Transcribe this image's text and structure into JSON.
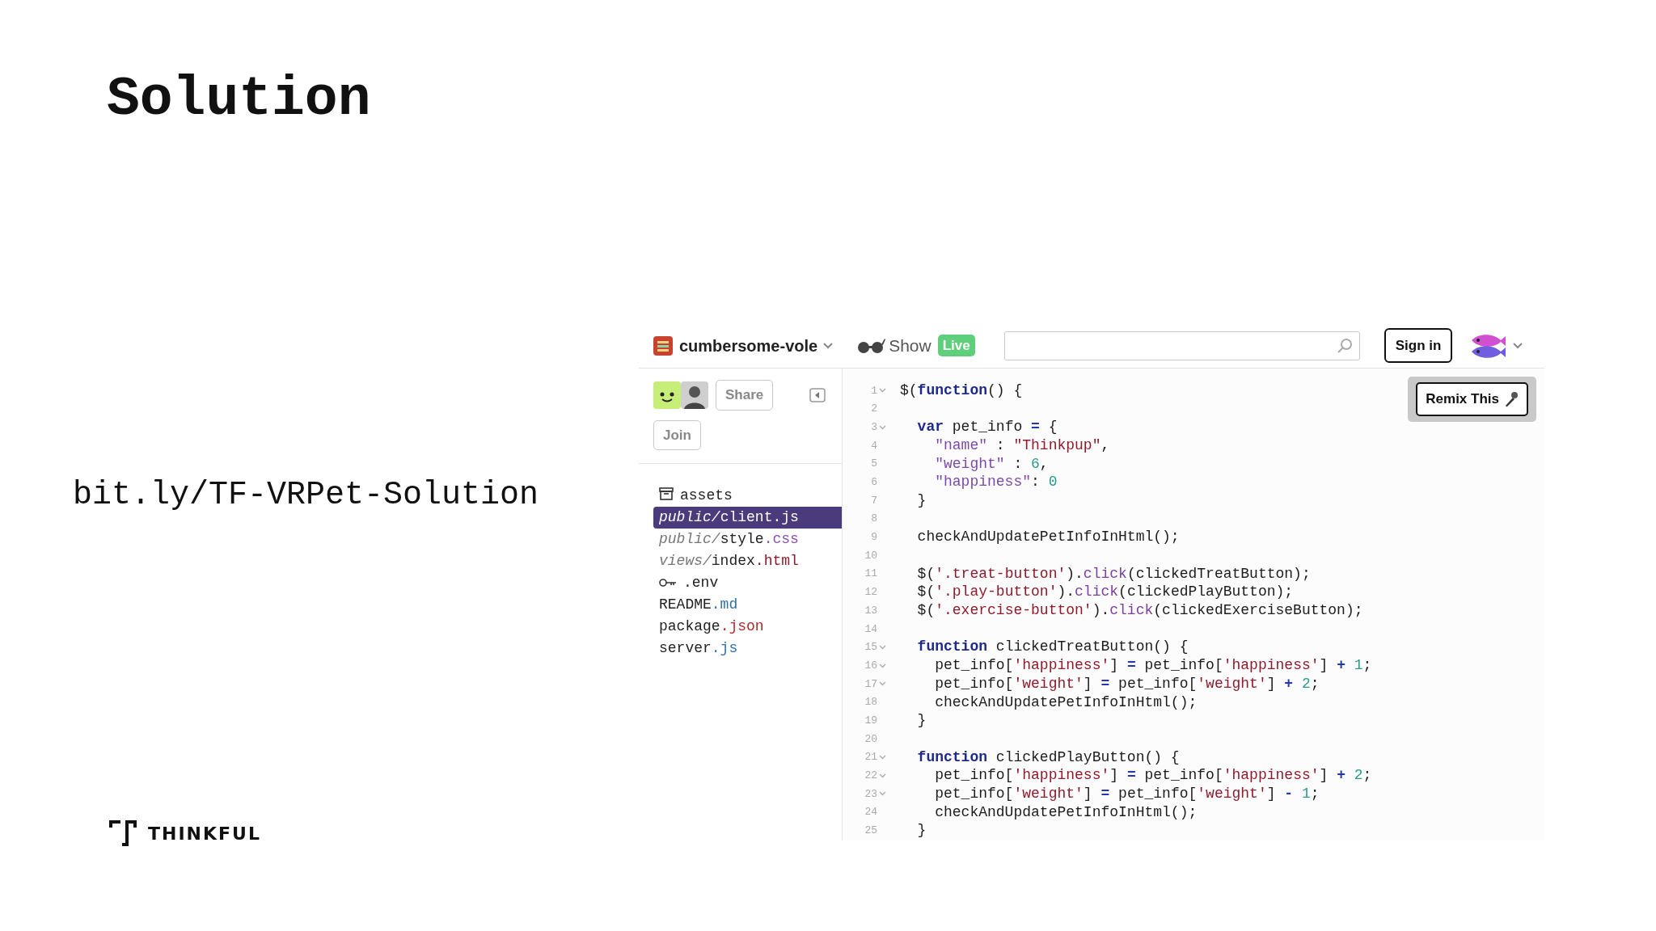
{
  "slide": {
    "title": "Solution",
    "link": "bit.ly/TF-VRPet-Solution",
    "brand": "THINKFUL"
  },
  "editor": {
    "project_name": "cumbersome-vole",
    "show_label": "Show",
    "live_badge": "Live",
    "sign_in": "Sign in",
    "share": "Share",
    "join": "Join",
    "remix": "Remix This",
    "files": [
      {
        "kind": "assets",
        "name": "assets",
        "selected": false
      },
      {
        "kind": "file",
        "dir": "public/",
        "name": "client",
        "ext": ".js",
        "selected": true
      },
      {
        "kind": "file",
        "dir": "public/",
        "name": "style",
        "ext": ".css",
        "color": "#8a4fb0",
        "selected": false
      },
      {
        "kind": "file",
        "dir": "views/",
        "name": "index",
        "ext": ".html",
        "color": "#8b1a2b",
        "selected": false
      },
      {
        "kind": "key",
        "name": ".env",
        "selected": false
      },
      {
        "kind": "file",
        "name": "README",
        "ext": ".md",
        "color": "#2f6fb0",
        "selected": false
      },
      {
        "kind": "file",
        "name": "package",
        "ext": ".json",
        "color": "#b02a2a",
        "selected": false
      },
      {
        "kind": "file",
        "name": "server",
        "ext": ".js",
        "color": "#2f6fb0",
        "selected": false
      }
    ],
    "code": [
      {
        "number": "1",
        "foldable": true,
        "tokens": [
          {
            "kind": "plain",
            "text": "$("
          },
          {
            "kind": "keyword",
            "text": "function"
          },
          {
            "kind": "plain",
            "text": "() {"
          }
        ]
      },
      {
        "number": "2",
        "foldable": false
      },
      {
        "number": "3",
        "foldable": true,
        "tokens": [
          {
            "kind": "keyword",
            "text": "  var"
          },
          {
            "kind": "plain",
            "text": " pet_info "
          },
          {
            "kind": "operator",
            "text": "="
          },
          {
            "kind": "plain",
            "text": " {"
          }
        ]
      },
      {
        "number": "4",
        "foldable": false,
        "tokens": [
          {
            "kind": "property",
            "text": "    \"name\""
          },
          {
            "kind": "plain",
            "text": " : "
          },
          {
            "kind": "string",
            "text": "\"Thinkpup\""
          },
          {
            "kind": "plain",
            "text": ","
          }
        ]
      },
      {
        "number": "5",
        "foldable": false,
        "tokens": [
          {
            "kind": "property",
            "text": "    \"weight\""
          },
          {
            "kind": "plain",
            "text": " : "
          },
          {
            "kind": "number",
            "text": "6"
          },
          {
            "kind": "plain",
            "text": ","
          }
        ]
      },
      {
        "number": "6",
        "foldable": false,
        "tokens": [
          {
            "kind": "property",
            "text": "    \"happiness\""
          },
          {
            "kind": "plain",
            "text": ": "
          },
          {
            "kind": "number",
            "text": "0"
          }
        ]
      },
      {
        "number": "7",
        "foldable": false,
        "tokens": [
          {
            "kind": "plain",
            "text": "  }"
          }
        ]
      },
      {
        "number": "8",
        "foldable": false
      },
      {
        "number": "9",
        "foldable": false,
        "tokens": [
          {
            "kind": "plain",
            "text": "  checkAndUpdatePetInfoInHtml();"
          }
        ]
      },
      {
        "number": "10",
        "foldable": false
      },
      {
        "number": "11",
        "foldable": false,
        "tokens": [
          {
            "kind": "plain",
            "text": "  $("
          },
          {
            "kind": "string",
            "text": "'.treat-button'"
          },
          {
            "kind": "plain",
            "text": ")."
          },
          {
            "kind": "method",
            "text": "click"
          },
          {
            "kind": "plain",
            "text": "(clickedTreatButton);"
          }
        ]
      },
      {
        "number": "12",
        "foldable": false,
        "tokens": [
          {
            "kind": "plain",
            "text": "  $("
          },
          {
            "kind": "string",
            "text": "'.play-button'"
          },
          {
            "kind": "plain",
            "text": ")."
          },
          {
            "kind": "method",
            "text": "click"
          },
          {
            "kind": "plain",
            "text": "(clickedPlayButton);"
          }
        ]
      },
      {
        "number": "13",
        "foldable": false,
        "tokens": [
          {
            "kind": "plain",
            "text": "  $("
          },
          {
            "kind": "string",
            "text": "'.exercise-button'"
          },
          {
            "kind": "plain",
            "text": ")."
          },
          {
            "kind": "method",
            "text": "click"
          },
          {
            "kind": "plain",
            "text": "(clickedExerciseButton);"
          }
        ]
      },
      {
        "number": "14",
        "foldable": false
      },
      {
        "number": "15",
        "foldable": true,
        "tokens": [
          {
            "kind": "keyword",
            "text": "  function"
          },
          {
            "kind": "plain",
            "text": " clickedTreatButton() {"
          }
        ]
      },
      {
        "number": "16",
        "foldable": true,
        "tokens": [
          {
            "kind": "plain",
            "text": "    pet_info["
          },
          {
            "kind": "string",
            "text": "'happiness'"
          },
          {
            "kind": "plain",
            "text": "] "
          },
          {
            "kind": "operator",
            "text": "="
          },
          {
            "kind": "plain",
            "text": " pet_info["
          },
          {
            "kind": "string",
            "text": "'happiness'"
          },
          {
            "kind": "plain",
            "text": "] "
          },
          {
            "kind": "operator",
            "text": "+"
          },
          {
            "kind": "number",
            "text": " 1"
          },
          {
            "kind": "plain",
            "text": ";"
          }
        ]
      },
      {
        "number": "17",
        "foldable": true,
        "tokens": [
          {
            "kind": "plain",
            "text": "    pet_info["
          },
          {
            "kind": "string",
            "text": "'weight'"
          },
          {
            "kind": "plain",
            "text": "] "
          },
          {
            "kind": "operator",
            "text": "="
          },
          {
            "kind": "plain",
            "text": " pet_info["
          },
          {
            "kind": "string",
            "text": "'weight'"
          },
          {
            "kind": "plain",
            "text": "] "
          },
          {
            "kind": "operator",
            "text": "+"
          },
          {
            "kind": "number",
            "text": " 2"
          },
          {
            "kind": "plain",
            "text": ";"
          }
        ]
      },
      {
        "number": "18",
        "foldable": false,
        "tokens": [
          {
            "kind": "plain",
            "text": "    checkAndUpdatePetInfoInHtml();"
          }
        ]
      },
      {
        "number": "19",
        "foldable": false,
        "tokens": [
          {
            "kind": "plain",
            "text": "  }"
          }
        ]
      },
      {
        "number": "20",
        "foldable": false
      },
      {
        "number": "21",
        "foldable": true,
        "tokens": [
          {
            "kind": "keyword",
            "text": "  function"
          },
          {
            "kind": "plain",
            "text": " clickedPlayButton() {"
          }
        ]
      },
      {
        "number": "22",
        "foldable": true,
        "tokens": [
          {
            "kind": "plain",
            "text": "    pet_info["
          },
          {
            "kind": "string",
            "text": "'happiness'"
          },
          {
            "kind": "plain",
            "text": "] "
          },
          {
            "kind": "operator",
            "text": "="
          },
          {
            "kind": "plain",
            "text": " pet_info["
          },
          {
            "kind": "string",
            "text": "'happiness'"
          },
          {
            "kind": "plain",
            "text": "] "
          },
          {
            "kind": "operator",
            "text": "+"
          },
          {
            "kind": "number",
            "text": " 2"
          },
          {
            "kind": "plain",
            "text": ";"
          }
        ]
      },
      {
        "number": "23",
        "foldable": true,
        "tokens": [
          {
            "kind": "plain",
            "text": "    pet_info["
          },
          {
            "kind": "string",
            "text": "'weight'"
          },
          {
            "kind": "plain",
            "text": "] "
          },
          {
            "kind": "operator",
            "text": "="
          },
          {
            "kind": "plain",
            "text": " pet_info["
          },
          {
            "kind": "string",
            "text": "'weight'"
          },
          {
            "kind": "plain",
            "text": "] "
          },
          {
            "kind": "operator",
            "text": "-"
          },
          {
            "kind": "number",
            "text": " 1"
          },
          {
            "kind": "plain",
            "text": ";"
          }
        ]
      },
      {
        "number": "24",
        "foldable": false,
        "tokens": [
          {
            "kind": "plain",
            "text": "    checkAndUpdatePetInfoInHtml();"
          }
        ]
      },
      {
        "number": "25",
        "foldable": false,
        "tokens": [
          {
            "kind": "plain",
            "text": "  }"
          }
        ]
      }
    ]
  }
}
